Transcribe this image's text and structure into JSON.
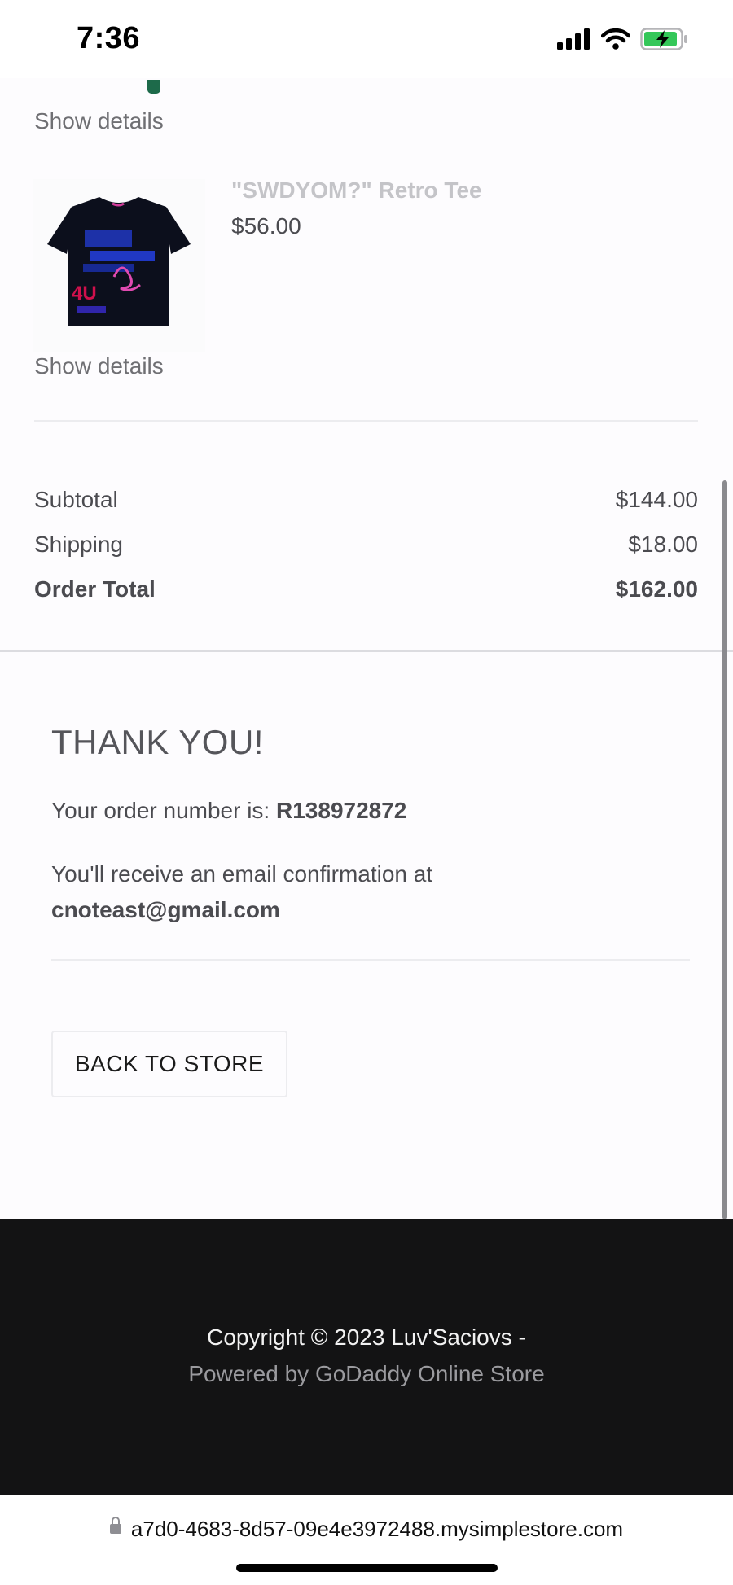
{
  "status_bar": {
    "time": "7:36"
  },
  "items": [
    {
      "show_details": "Show details"
    },
    {
      "name": "\"SWDYOM?\" Retro Tee",
      "price": "$56.00",
      "show_details": "Show details"
    }
  ],
  "summary": {
    "subtotal_label": "Subtotal",
    "subtotal_value": "$144.00",
    "shipping_label": "Shipping",
    "shipping_value": "$18.00",
    "total_label": "Order Total",
    "total_value": "$162.00"
  },
  "confirmation": {
    "heading": "THANK YOU!",
    "order_prefix": "Your order number is: ",
    "order_number": "R138972872",
    "email_prefix": "You'll receive an email confirmation at",
    "email": "cnoteast@gmail.com",
    "back_button": "BACK TO STORE"
  },
  "footer": {
    "copyright": "Copyright © 2023 Luv'Saciovs -",
    "powered": "Powered by GoDaddy Online Store"
  },
  "browser": {
    "url": "a7d0-4683-8d57-09e4e3972488.mysimplestore.com"
  },
  "colors": {
    "footer_bg": "#131314",
    "battery_green": "#34c759"
  }
}
